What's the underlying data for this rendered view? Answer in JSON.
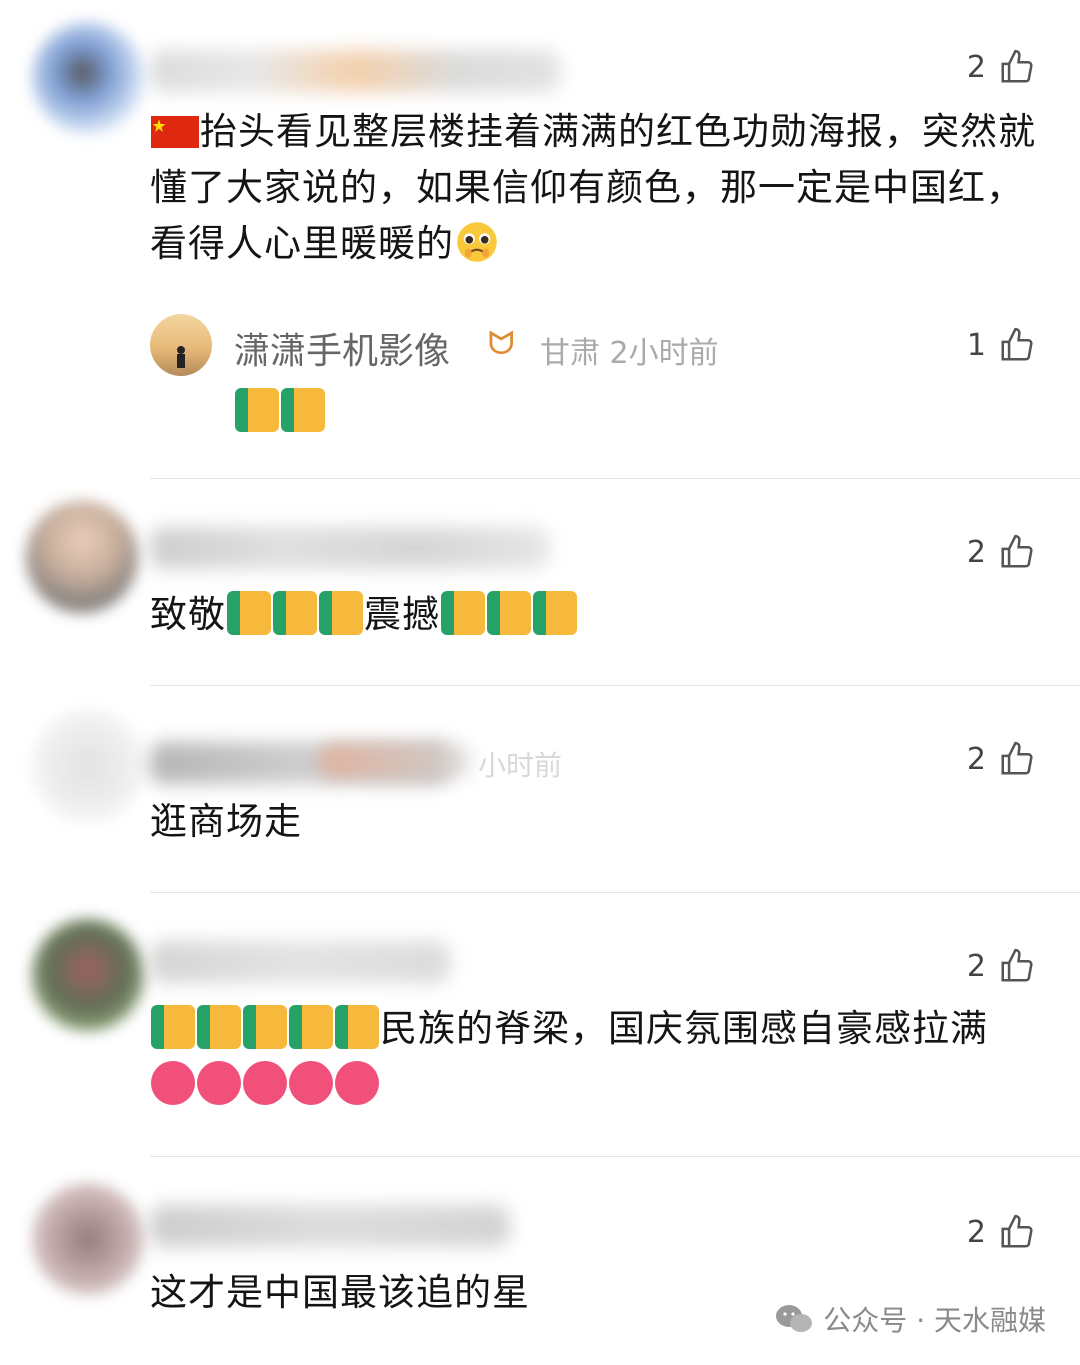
{
  "comments": [
    {
      "text": "抬头看见整层楼挂着满满的红色功勋海报，突然就懂了大家说的，如果信仰有颜色，那一定是中国红，看得人心里暖暖的",
      "likes": "2"
    },
    {
      "text": "致敬",
      "text2": "震撼",
      "likes": "2"
    },
    {
      "text": "逛商场走",
      "likes": "2"
    },
    {
      "text": "民族的脊梁，国庆氛围感自豪感拉满",
      "likes": "2"
    },
    {
      "text": "这才是中国最该追的星",
      "likes": "2"
    }
  ],
  "reply": {
    "name": "潇潇手机影像",
    "location_time": "甘肃 2小时前",
    "likes": "1"
  },
  "faint_time": "小时前",
  "watermark": "公众号 · 天水融媒"
}
